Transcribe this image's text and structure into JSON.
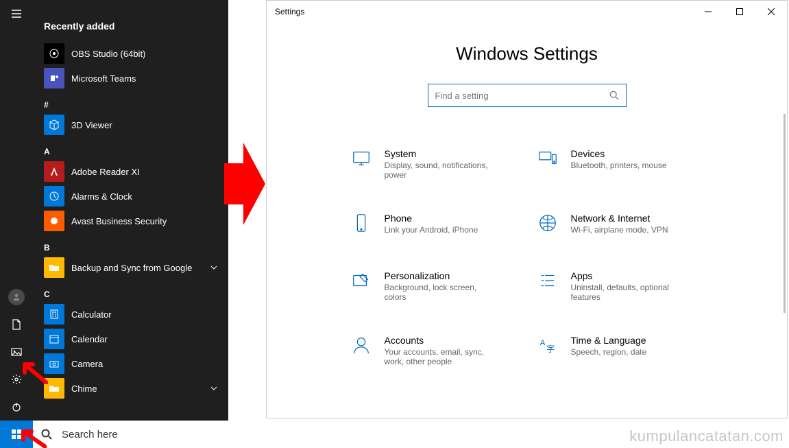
{
  "start_menu": {
    "header": "Recently added",
    "recent": [
      {
        "label": "OBS Studio (64bit)"
      },
      {
        "label": "Microsoft Teams"
      }
    ],
    "groups": [
      {
        "letter": "#",
        "items": [
          {
            "label": "3D Viewer"
          }
        ]
      },
      {
        "letter": "A",
        "items": [
          {
            "label": "Adobe Reader XI"
          },
          {
            "label": "Alarms & Clock"
          },
          {
            "label": "Avast Business Security"
          }
        ]
      },
      {
        "letter": "B",
        "items": [
          {
            "label": "Backup and Sync from Google",
            "expandable": true
          }
        ]
      },
      {
        "letter": "C",
        "items": [
          {
            "label": "Calculator"
          },
          {
            "label": "Calendar"
          },
          {
            "label": "Camera"
          },
          {
            "label": "Chime",
            "expandable": true
          }
        ]
      }
    ],
    "search_placeholder": "Search here"
  },
  "settings": {
    "window_title": "Settings",
    "page_title": "Windows Settings",
    "search_placeholder": "Find a setting",
    "categories": [
      {
        "id": "system",
        "title": "System",
        "subtitle": "Display, sound, notifications, power"
      },
      {
        "id": "devices",
        "title": "Devices",
        "subtitle": "Bluetooth, printers, mouse"
      },
      {
        "id": "phone",
        "title": "Phone",
        "subtitle": "Link your Android, iPhone"
      },
      {
        "id": "network",
        "title": "Network & Internet",
        "subtitle": "Wi-Fi, airplane mode, VPN"
      },
      {
        "id": "personalization",
        "title": "Personalization",
        "subtitle": "Background, lock screen, colors"
      },
      {
        "id": "apps",
        "title": "Apps",
        "subtitle": "Uninstall, defaults, optional features"
      },
      {
        "id": "accounts",
        "title": "Accounts",
        "subtitle": "Your accounts, email, sync, work, other people"
      },
      {
        "id": "time",
        "title": "Time & Language",
        "subtitle": "Speech, region, date"
      }
    ]
  },
  "watermark": "kumpulancatatan.com"
}
